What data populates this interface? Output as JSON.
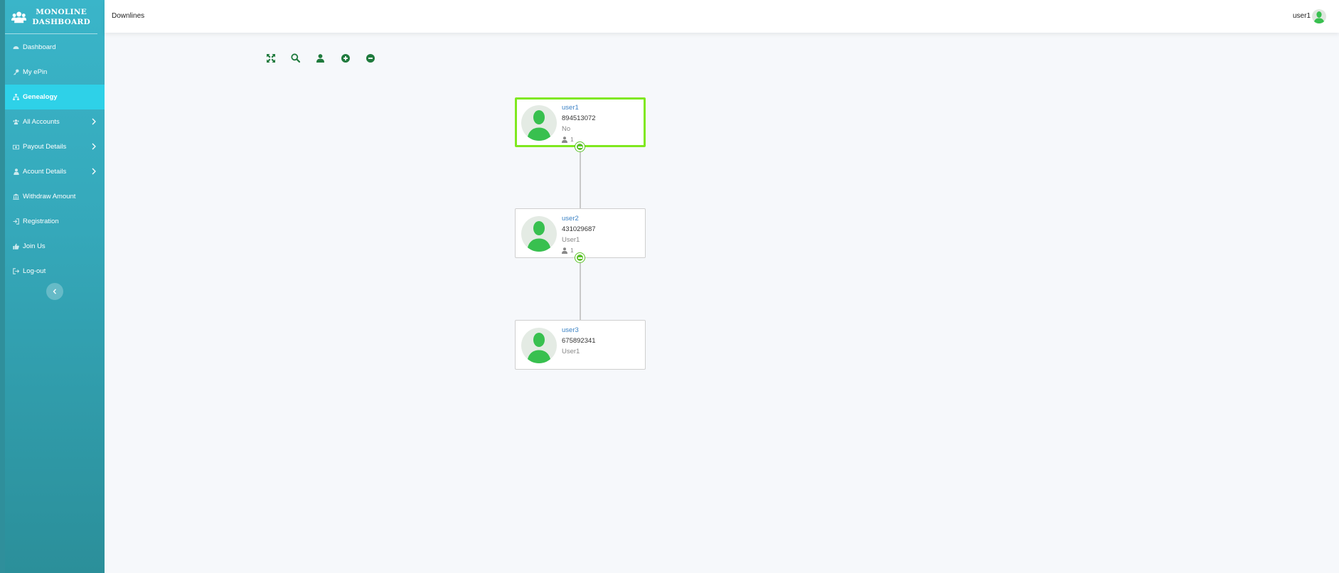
{
  "brand": {
    "line1": "MONOLINE",
    "line2": "DASHBOARD"
  },
  "sidebar": {
    "items": [
      {
        "label": "Dashboard",
        "icon": "dashboard-icon",
        "active": false,
        "submenu": false
      },
      {
        "label": "My ePin",
        "icon": "key-icon",
        "active": false,
        "submenu": false
      },
      {
        "label": "Genealogy",
        "icon": "sitemap-icon",
        "active": true,
        "submenu": false
      },
      {
        "label": "All Accounts",
        "icon": "users-icon",
        "active": false,
        "submenu": true
      },
      {
        "label": "Payout Details",
        "icon": "money-icon",
        "active": false,
        "submenu": true
      },
      {
        "label": "Acount Details",
        "icon": "user-icon",
        "active": false,
        "submenu": true
      },
      {
        "label": "Withdraw Amount",
        "icon": "bank-icon",
        "active": false,
        "submenu": false
      },
      {
        "label": "Registration",
        "icon": "sign-in-icon",
        "active": false,
        "submenu": false
      },
      {
        "label": "Join Us",
        "icon": "thumbs-up-icon",
        "active": false,
        "submenu": false
      },
      {
        "label": "Log-out",
        "icon": "sign-out-icon",
        "active": false,
        "submenu": false
      }
    ],
    "collapse_icon": "chevron-left-icon"
  },
  "header": {
    "title": "Downlines",
    "user": "user1"
  },
  "toolbar": [
    "expand-icon",
    "search-icon",
    "user-icon",
    "zoom-in-icon",
    "zoom-out-icon"
  ],
  "tree": {
    "nodes": [
      {
        "name": "user1",
        "code": "894513072",
        "sponsor": "No",
        "count": "1",
        "selected": true
      },
      {
        "name": "user2",
        "code": "431029687",
        "sponsor": "User1",
        "count": "1",
        "selected": false
      },
      {
        "name": "user3",
        "code": "675892341",
        "sponsor": "User1",
        "count": "",
        "selected": false
      }
    ]
  },
  "colors": {
    "accent": "#2ed1e8",
    "sidebar": "#35a8ba",
    "icon_green": "#1f7a3d",
    "selected_border": "#7fe81f",
    "node_name": "#3b82c4"
  }
}
